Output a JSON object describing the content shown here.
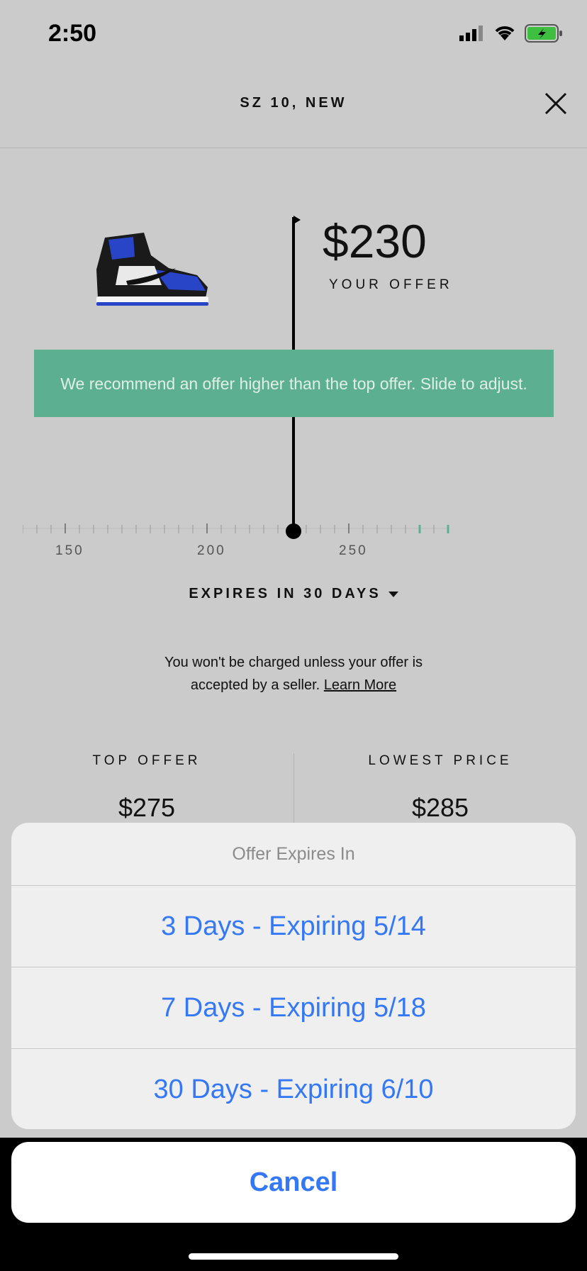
{
  "status_bar": {
    "time": "2:50"
  },
  "header": {
    "title": "SZ 10, NEW"
  },
  "offer": {
    "price": "$230",
    "label": "YOUR OFFER",
    "recommendation": "We recommend an offer higher than the top offer. Slide to adjust."
  },
  "slider": {
    "ticks": [
      "150",
      "200",
      "250"
    ],
    "value": 230
  },
  "expiry": {
    "label": "EXPIRES IN 30 DAYS"
  },
  "note": {
    "text": "You won't be charged unless your offer is accepted by a seller.",
    "link": "Learn More"
  },
  "stats": {
    "top_offer_label": "TOP OFFER",
    "top_offer_value": "$275",
    "lowest_price_label": "LOWEST PRICE",
    "lowest_price_value": "$285"
  },
  "sheet": {
    "title": "Offer Expires In",
    "options": [
      "3 Days - Expiring 5/14",
      "7 Days - Expiring 5/18",
      "30 Days - Expiring 6/10"
    ],
    "cancel": "Cancel"
  },
  "colors": {
    "accent_green": "#5cb091",
    "ios_blue": "#3478f6"
  },
  "icons": {
    "close": "close-icon",
    "signal": "signal-icon",
    "wifi": "wifi-icon",
    "battery": "battery-icon"
  }
}
